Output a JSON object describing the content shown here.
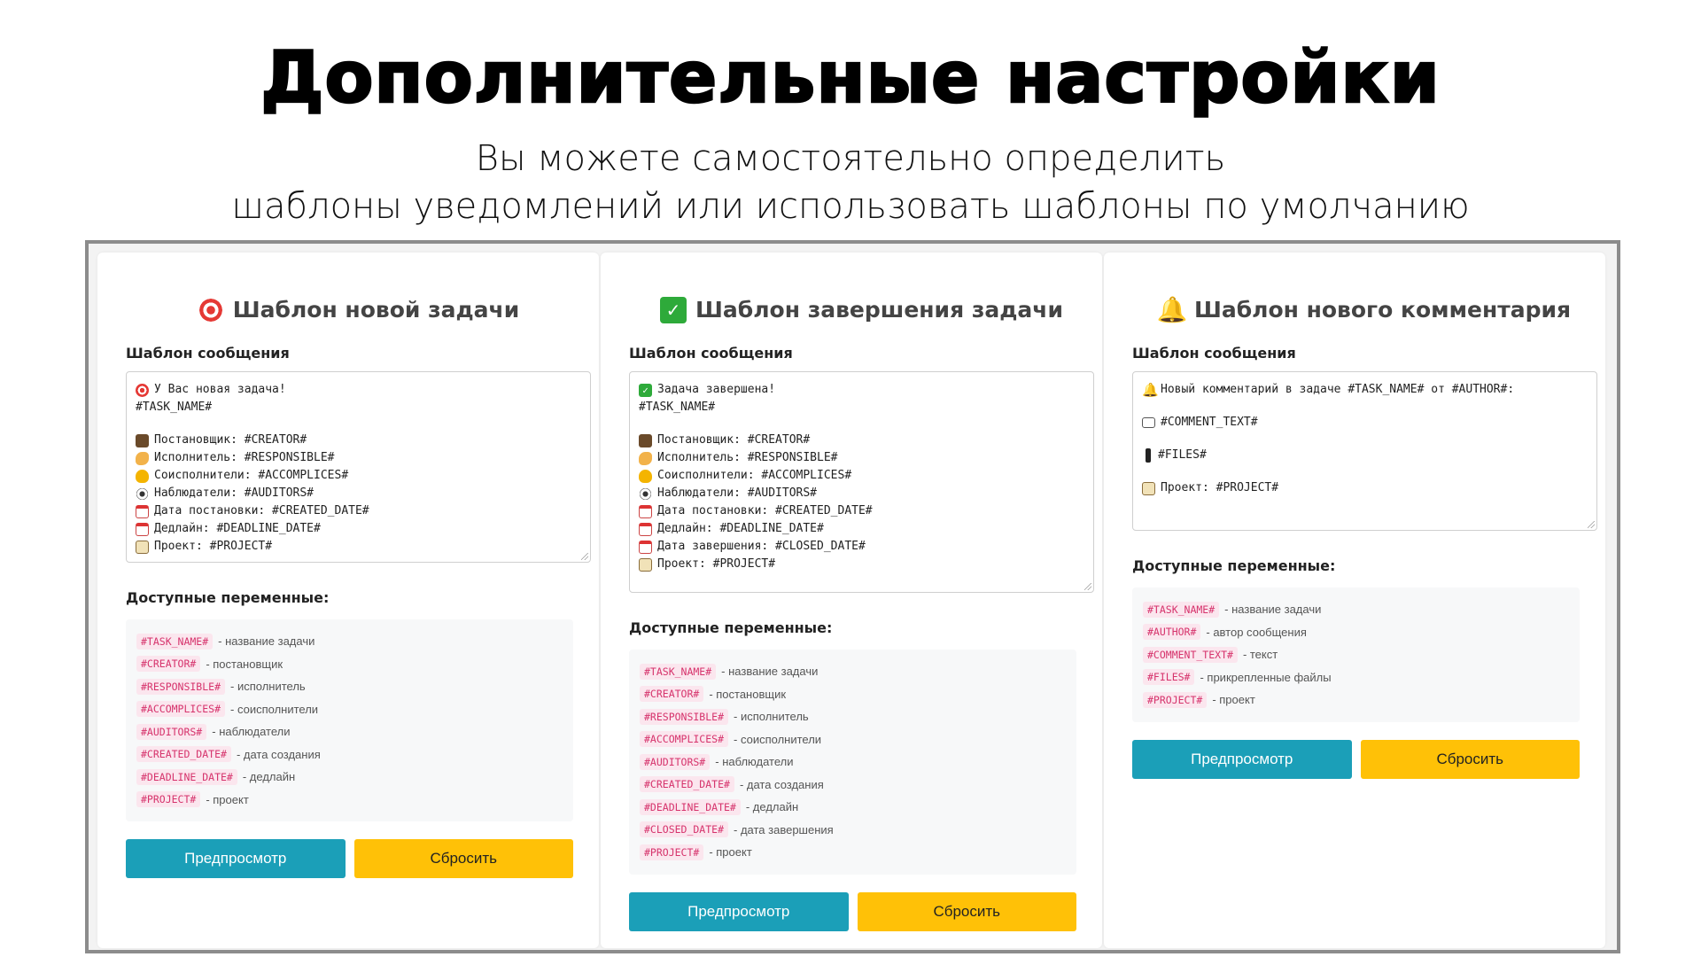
{
  "hero": {
    "title": "Дополнительные настройки",
    "subtitle_line1": "Вы можете самостоятельно определить",
    "subtitle_line2": "шаблоны уведомлений или использовать шаблоны по умолчанию"
  },
  "common": {
    "message_template_label": "Шаблон сообщения",
    "vars_label": "Доступные переменные:",
    "preview_button": "Предпросмотр",
    "reset_button": "Сбросить"
  },
  "colors": {
    "preview": "#1b9fb8",
    "reset": "#ffc107",
    "code": "#d6336c"
  },
  "cards": [
    {
      "icon": "target-icon",
      "title": "Шаблон новой задачи",
      "template_lines": [
        {
          "icon": "target-icon",
          "text": "У Вас новая задача!"
        },
        {
          "icon": "",
          "text": "#TASK_NAME#"
        },
        {
          "icon": "",
          "text": ""
        },
        {
          "icon": "creator-icon",
          "text": "Постановщик: #CREATOR#"
        },
        {
          "icon": "muscle-icon",
          "text": "Исполнитель: #RESPONSIBLE#"
        },
        {
          "icon": "heart-icon",
          "text": "Соисполнители: #ACCOMPLICES#"
        },
        {
          "icon": "eye-icon",
          "text": "Наблюдатели: #AUDITORS#"
        },
        {
          "icon": "calendar-icon",
          "text": "Дата постановки: #CREATED_DATE#"
        },
        {
          "icon": "calendar-icon",
          "text": "Дедлайн: #DEADLINE_DATE#"
        },
        {
          "icon": "clipboard-icon",
          "text": "Проект: #PROJECT#"
        }
      ],
      "variables": [
        {
          "code": "#TASK_NAME#",
          "desc": "- название задачи"
        },
        {
          "code": "#CREATOR#",
          "desc": "- постановщик"
        },
        {
          "code": "#RESPONSIBLE#",
          "desc": "- исполнитель"
        },
        {
          "code": "#ACCOMPLICES#",
          "desc": "- соисполнители"
        },
        {
          "code": "#AUDITORS#",
          "desc": "- наблюдатели"
        },
        {
          "code": "#CREATED_DATE#",
          "desc": "- дата создания"
        },
        {
          "code": "#DEADLINE_DATE#",
          "desc": "- дедлайн"
        },
        {
          "code": "#PROJECT#",
          "desc": "- проект"
        }
      ]
    },
    {
      "icon": "check-icon",
      "title": "Шаблон завершения задачи",
      "template_lines": [
        {
          "icon": "check-icon",
          "text": "Задача завершена!"
        },
        {
          "icon": "",
          "text": "#TASK_NAME#"
        },
        {
          "icon": "",
          "text": ""
        },
        {
          "icon": "creator-icon",
          "text": "Постановщик: #CREATOR#"
        },
        {
          "icon": "muscle-icon",
          "text": "Исполнитель: #RESPONSIBLE#"
        },
        {
          "icon": "heart-icon",
          "text": "Соисполнители: #ACCOMPLICES#"
        },
        {
          "icon": "eye-icon",
          "text": "Наблюдатели: #AUDITORS#"
        },
        {
          "icon": "calendar-icon",
          "text": "Дата постановки: #CREATED_DATE#"
        },
        {
          "icon": "calendar-icon",
          "text": "Дедлайн: #DEADLINE_DATE#"
        },
        {
          "icon": "calendar-icon",
          "text": "Дата завершения: #CLOSED_DATE#"
        },
        {
          "icon": "clipboard-icon",
          "text": "Проект: #PROJECT#"
        }
      ],
      "variables": [
        {
          "code": "#TASK_NAME#",
          "desc": "- название задачи"
        },
        {
          "code": "#CREATOR#",
          "desc": "- постановщик"
        },
        {
          "code": "#RESPONSIBLE#",
          "desc": "- исполнитель"
        },
        {
          "code": "#ACCOMPLICES#",
          "desc": "- соисполнители"
        },
        {
          "code": "#AUDITORS#",
          "desc": "- наблюдатели"
        },
        {
          "code": "#CREATED_DATE#",
          "desc": "- дата создания"
        },
        {
          "code": "#DEADLINE_DATE#",
          "desc": "- дедлайн"
        },
        {
          "code": "#CLOSED_DATE#",
          "desc": "- дата завершения"
        },
        {
          "code": "#PROJECT#",
          "desc": "- проект"
        }
      ]
    },
    {
      "icon": "bell-icon",
      "title": "Шаблон нового комментария",
      "template_lines": [
        {
          "icon": "bell-icon",
          "text": "Новый комментарий в задаче #TASK_NAME# от #AUTHOR#:"
        },
        {
          "icon": "",
          "text": ""
        },
        {
          "icon": "speech-icon",
          "text": "#COMMENT_TEXT#"
        },
        {
          "icon": "",
          "text": ""
        },
        {
          "icon": "pin-icon",
          "text": "#FILES#"
        },
        {
          "icon": "",
          "text": ""
        },
        {
          "icon": "clipboard-icon",
          "text": "Проект: #PROJECT#"
        }
      ],
      "variables": [
        {
          "code": "#TASK_NAME#",
          "desc": "- название задачи"
        },
        {
          "code": "#AUTHOR#",
          "desc": "- автор сообщения"
        },
        {
          "code": "#COMMENT_TEXT#",
          "desc": "- текст"
        },
        {
          "code": "#FILES#",
          "desc": "- прикрепленные файлы"
        },
        {
          "code": "#PROJECT#",
          "desc": "- проект"
        }
      ]
    }
  ]
}
